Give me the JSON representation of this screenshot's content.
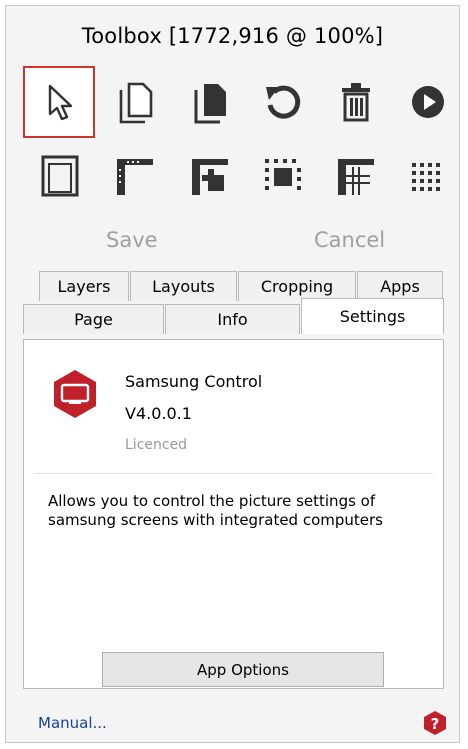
{
  "window": {
    "title": "Toolbox [1772,916 @ 100%]"
  },
  "toolbar": {
    "row1": [
      "select-pointer-icon",
      "new-page-icon",
      "copy-page-icon",
      "rotate-icon",
      "delete-icon",
      "play-icon"
    ],
    "row2": [
      "page-frame-icon",
      "layout-corner-icon",
      "layout-split-icon",
      "layout-center-icon",
      "layout-grid-icon",
      "layout-dots-icon"
    ]
  },
  "actions": {
    "save": "Save",
    "cancel": "Cancel"
  },
  "tabs": {
    "row1": [
      "Layers",
      "Layouts",
      "Cropping",
      "Apps"
    ],
    "row2": [
      "Page",
      "Info",
      "Settings"
    ],
    "selected": "Settings"
  },
  "app": {
    "name": "Samsung Control",
    "version": "V4.0.0.1",
    "status": "Licenced",
    "description": "Allows you to control the picture settings of samsung screens with integrated computers",
    "options_button": "App Options"
  },
  "footer": {
    "manual_link": "Manual...",
    "help_icon": "help-icon"
  },
  "colors": {
    "accent_red": "#d0342c",
    "icon_dark": "#333333",
    "link_blue": "#1a3fa8",
    "disabled_text": "#a0a0a0"
  }
}
